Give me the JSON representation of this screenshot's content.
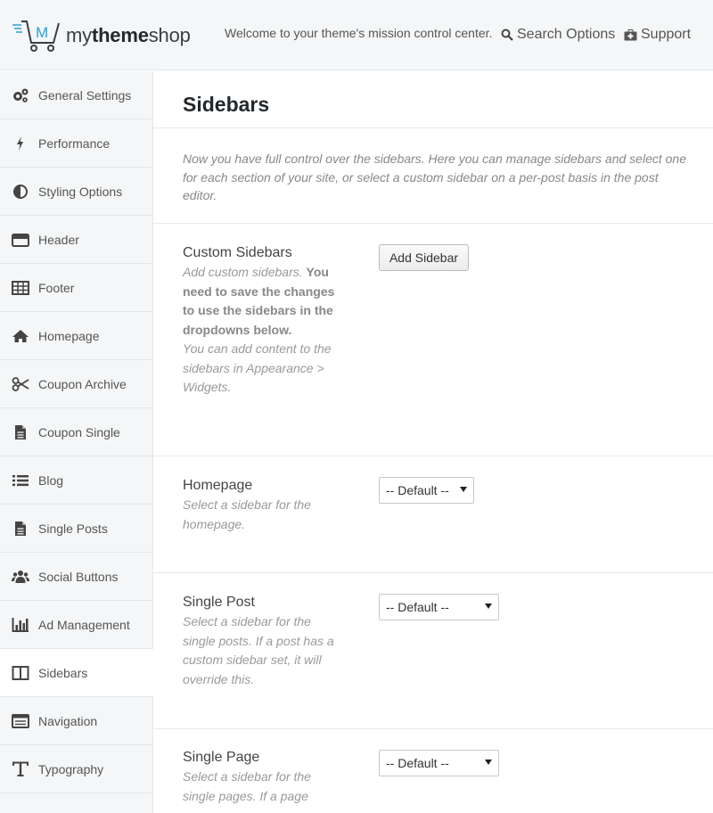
{
  "header": {
    "logo_prefix": "my",
    "logo_bold": "theme",
    "logo_suffix": "shop",
    "welcome": "Welcome to your theme's mission control center.",
    "search_label": "Search Options",
    "support_label": "Support"
  },
  "sidebar": {
    "items": [
      {
        "label": "General Settings",
        "icon": "gears-icon"
      },
      {
        "label": "Performance",
        "icon": "bolt-icon"
      },
      {
        "label": "Styling Options",
        "icon": "contrast-icon"
      },
      {
        "label": "Header",
        "icon": "header-icon"
      },
      {
        "label": "Footer",
        "icon": "table-icon"
      },
      {
        "label": "Homepage",
        "icon": "home-icon"
      },
      {
        "label": "Coupon Archive",
        "icon": "scissors-icon"
      },
      {
        "label": "Coupon Single",
        "icon": "document-icon"
      },
      {
        "label": "Blog",
        "icon": "list-icon"
      },
      {
        "label": "Single Posts",
        "icon": "document-icon"
      },
      {
        "label": "Social Buttons",
        "icon": "users-icon"
      },
      {
        "label": "Ad Management",
        "icon": "bar-chart-icon"
      },
      {
        "label": "Sidebars",
        "icon": "columns-icon",
        "active": true
      },
      {
        "label": "Navigation",
        "icon": "navigation-icon"
      },
      {
        "label": "Typography",
        "icon": "text-icon"
      }
    ]
  },
  "main": {
    "title": "Sidebars",
    "intro": "Now you have full control over the sidebars. Here you can manage sidebars and select one for each section of your site, or select a custom sidebar on a per-post basis in the post editor.",
    "custom": {
      "title": "Custom Sidebars",
      "desc_pre": "Add custom sidebars. ",
      "desc_bold": "You need to save the changes to use the sidebars in the dropdowns below.",
      "desc_post": "You can add content to the sidebars in Appearance > Widgets.",
      "button": "Add Sidebar"
    },
    "homepage": {
      "title": "Homepage",
      "desc": "Select a sidebar for the homepage.",
      "selected": "-- Default --"
    },
    "single_post": {
      "title": "Single Post",
      "desc": "Select a sidebar for the single posts. If a post has a custom sidebar set, it will override this.",
      "selected": "-- Default --"
    },
    "single_page": {
      "title": "Single Page",
      "desc": "Select a sidebar for the single pages. If a page",
      "selected": "-- Default --"
    }
  },
  "colors": {
    "sidebar_bg": "#f5f6f7",
    "border": "#e4e6e8",
    "logo_accent": "#2d9fd8"
  }
}
